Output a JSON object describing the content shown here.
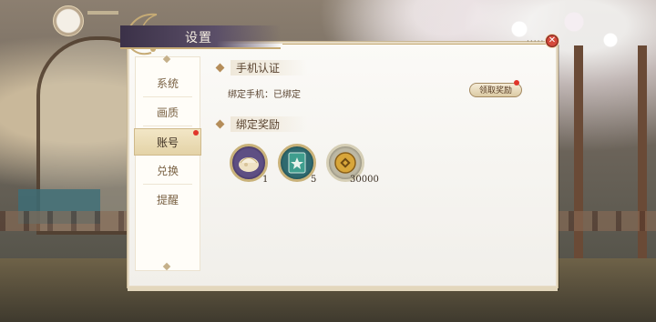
{
  "dialog": {
    "title": "设置",
    "close_icon": "close-icon",
    "close_label": "✕"
  },
  "sidebar": {
    "items": [
      {
        "label": "系统"
      },
      {
        "label": "画质"
      },
      {
        "label": "账号",
        "active": true,
        "has_notice": true
      },
      {
        "label": "兑换"
      },
      {
        "label": "提醒"
      }
    ]
  },
  "phone_section": {
    "heading": "手机认证",
    "status": "绑定手机：已绑定",
    "claim_button": "领取奖励"
  },
  "reward_section": {
    "heading": "绑定奖励",
    "items": [
      {
        "icon": "fan-bun-icon",
        "quantity": "1"
      },
      {
        "icon": "book-icon",
        "quantity": "5"
      },
      {
        "icon": "coin-icon",
        "quantity": "30000"
      }
    ]
  },
  "colors": {
    "accent_red": "#e0352a",
    "title_bar": "#3b3148",
    "gold_trim": "#c6ab75"
  }
}
